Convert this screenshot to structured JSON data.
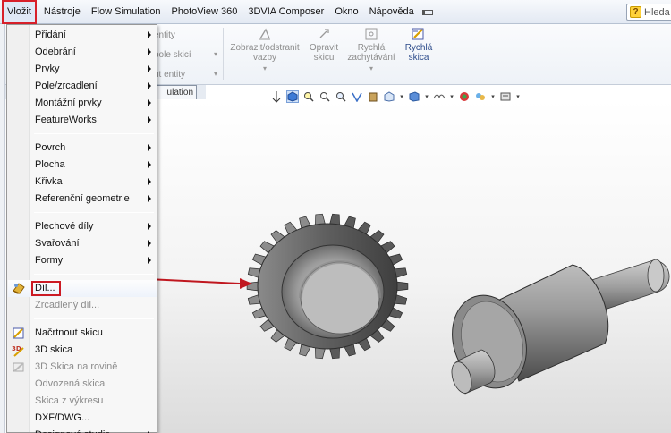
{
  "menubar": {
    "items": [
      "Vložit",
      "Nástroje",
      "Flow Simulation",
      "PhotoView 360",
      "3DVIA Composer",
      "Okno",
      "Nápověda"
    ],
    "active_index": 0,
    "search_label": "Hleda"
  },
  "ribbon": {
    "partial_labels": [
      "entity",
      "pole skicí",
      "ut entity"
    ],
    "buttons": [
      {
        "label": "Zobrazit/odstranit vazby",
        "enabled": false
      },
      {
        "label": "Opravit skicu",
        "enabled": false
      },
      {
        "label": "Rychlá zachytávání",
        "enabled": false
      },
      {
        "label": "Rychlá skica",
        "enabled": true
      }
    ],
    "tab_label": "ulation"
  },
  "menu": {
    "groups": [
      [
        {
          "label": "Přidání",
          "submenu": true
        },
        {
          "label": "Odebrání",
          "submenu": true
        },
        {
          "label": "Prvky",
          "submenu": true
        },
        {
          "label": "Pole/zrcadlení",
          "submenu": true
        },
        {
          "label": "Montážní prvky",
          "submenu": true
        },
        {
          "label": "FeatureWorks",
          "submenu": true
        }
      ],
      [
        {
          "label": "Povrch",
          "submenu": true
        },
        {
          "label": "Plocha",
          "submenu": true
        },
        {
          "label": "Křivka",
          "submenu": true
        },
        {
          "label": "Referenční geometrie",
          "submenu": true
        }
      ],
      [
        {
          "label": "Plechové díly",
          "submenu": true
        },
        {
          "label": "Svařování",
          "submenu": true
        },
        {
          "label": "Formy",
          "submenu": true
        }
      ],
      [
        {
          "label": "Díl...",
          "icon": "part-insert-icon",
          "highlighted": true
        },
        {
          "label": "Zrcadlený díl...",
          "disabled": true
        }
      ],
      [
        {
          "label": "Načrtnout skicu",
          "icon": "sketch-icon"
        },
        {
          "label": "3D skica",
          "icon": "3d-sketch-icon"
        },
        {
          "label": "3D Skica na rovině",
          "icon": "3d-sketch-plane-icon",
          "disabled": true
        },
        {
          "label": "Odvozená skica",
          "disabled": true
        },
        {
          "label": "Skica z výkresu",
          "disabled": true
        },
        {
          "label": "DXF/DWG..."
        },
        {
          "label": "Designová studie",
          "submenu": true
        }
      ]
    ]
  },
  "colors": {
    "highlight_border": "#cc1b24",
    "arrow": "#c0171f",
    "model_gray": "#6e6e6e"
  }
}
